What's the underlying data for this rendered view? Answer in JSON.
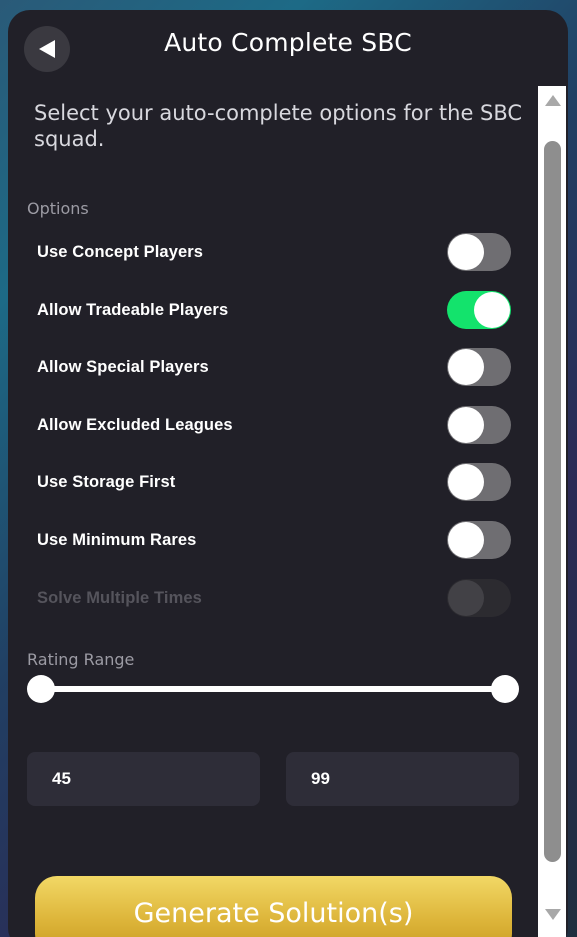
{
  "header": {
    "title": "Auto Complete SBC",
    "back_icon": "back-arrow-icon"
  },
  "subtitle": "Select your auto-complete options for the SBC squad.",
  "options_section": {
    "label": "Options",
    "items": [
      {
        "label": "Use Concept Players",
        "enabled": false,
        "disabled": false
      },
      {
        "label": "Allow Tradeable Players",
        "enabled": true,
        "disabled": false
      },
      {
        "label": "Allow Special Players",
        "enabled": false,
        "disabled": false
      },
      {
        "label": "Allow Excluded Leagues",
        "enabled": false,
        "disabled": false
      },
      {
        "label": "Use Storage First",
        "enabled": false,
        "disabled": false
      },
      {
        "label": "Use Minimum Rares",
        "enabled": false,
        "disabled": false
      },
      {
        "label": "Solve Multiple Times",
        "enabled": false,
        "disabled": true
      }
    ]
  },
  "rating_range": {
    "label": "Rating Range",
    "min_value": "45",
    "max_value": "99"
  },
  "generate_button": {
    "label": "Generate Solution(s)"
  },
  "colors": {
    "panel_bg": "#212028",
    "toggle_on": "#13e36c",
    "toggle_off": "#6f6e72",
    "button_gold": "#ddb53a"
  }
}
